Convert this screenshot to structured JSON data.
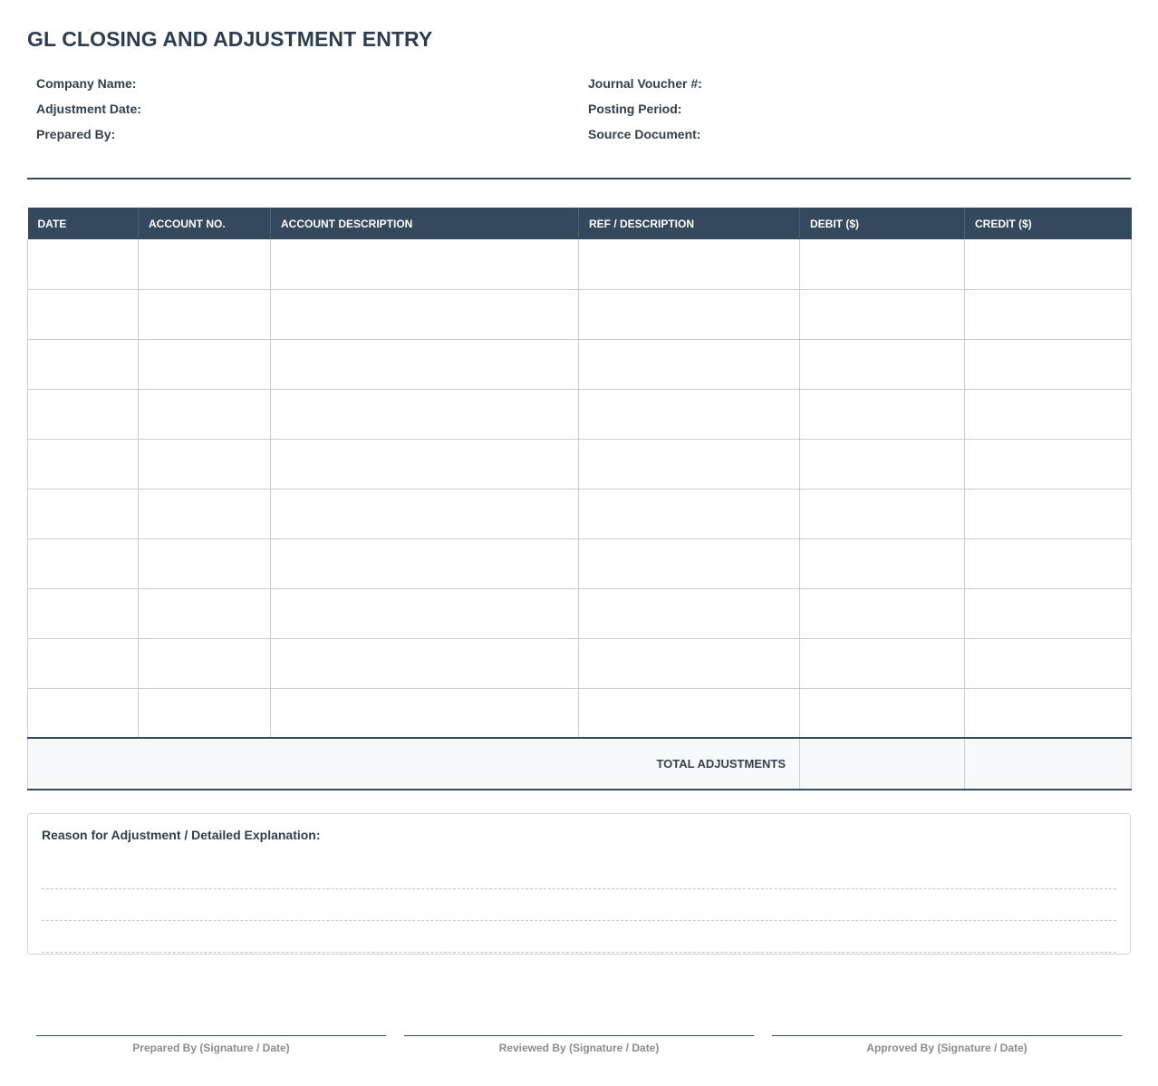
{
  "title": "GL CLOSING AND ADJUSTMENT ENTRY",
  "header_fields": {
    "left": [
      "Company Name:",
      "Adjustment Date:",
      "Prepared By:"
    ],
    "right": [
      "Journal Voucher #:",
      "Posting Period:",
      "Source Document:"
    ]
  },
  "table": {
    "columns": [
      "DATE",
      "ACCOUNT NO.",
      "ACCOUNT DESCRIPTION",
      "REF / DESCRIPTION",
      "DEBIT ($)",
      "CREDIT ($)"
    ],
    "rows": [
      [
        "",
        "",
        "",
        "",
        "",
        ""
      ],
      [
        "",
        "",
        "",
        "",
        "",
        ""
      ],
      [
        "",
        "",
        "",
        "",
        "",
        ""
      ],
      [
        "",
        "",
        "",
        "",
        "",
        ""
      ],
      [
        "",
        "",
        "",
        "",
        "",
        ""
      ],
      [
        "",
        "",
        "",
        "",
        "",
        ""
      ],
      [
        "",
        "",
        "",
        "",
        "",
        ""
      ],
      [
        "",
        "",
        "",
        "",
        "",
        ""
      ],
      [
        "",
        "",
        "",
        "",
        "",
        ""
      ],
      [
        "",
        "",
        "",
        "",
        "",
        ""
      ]
    ],
    "total_label": "TOTAL ADJUSTMENTS",
    "total_debit": "",
    "total_credit": ""
  },
  "reason": {
    "label": "Reason for Adjustment / Detailed Explanation:",
    "lines": [
      "",
      "",
      ""
    ]
  },
  "signatures": [
    "Prepared By (Signature / Date)",
    "Reviewed By (Signature / Date)",
    "Approved By (Signature / Date)"
  ]
}
